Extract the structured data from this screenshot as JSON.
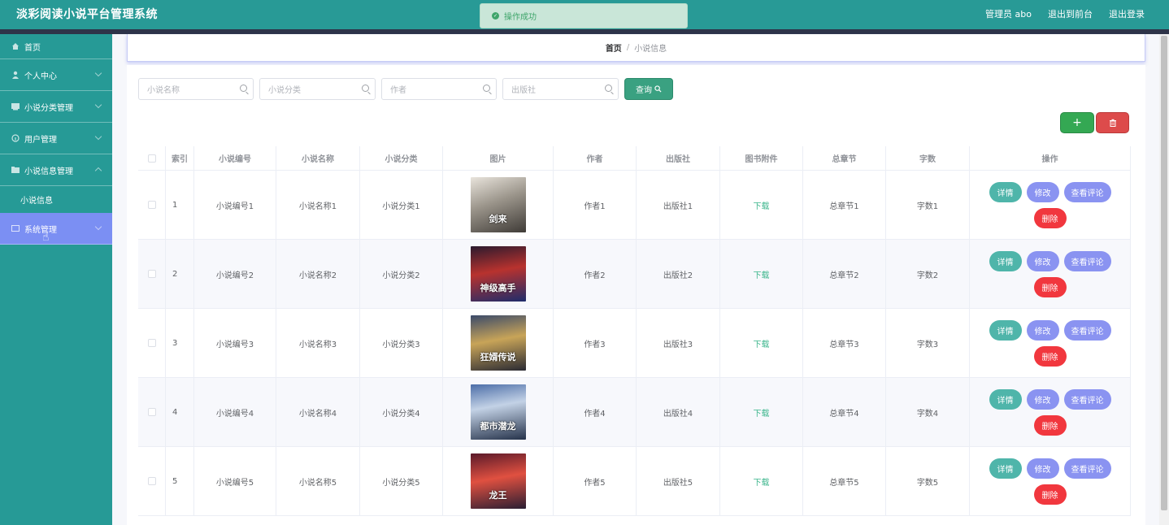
{
  "header": {
    "title": "淡彩阅读小说平台管理系统",
    "admin_label": "管理员 abo",
    "to_front_label": "退出到前台",
    "logout_label": "退出登录"
  },
  "toast": {
    "message": "操作成功"
  },
  "sidebar": {
    "items": [
      {
        "label": "首页",
        "icon": "home-icon"
      },
      {
        "label": "个人中心",
        "icon": "user-icon"
      },
      {
        "label": "小说分类管理",
        "icon": "list-icon"
      },
      {
        "label": "用户管理",
        "icon": "info-icon"
      },
      {
        "label": "小说信息管理",
        "icon": "folder-icon"
      },
      {
        "label": "小说信息",
        "icon": ""
      },
      {
        "label": "系统管理",
        "icon": "settings-icon"
      }
    ]
  },
  "breadcrumb": {
    "home": "首页",
    "separator": "/",
    "current": "小说信息"
  },
  "search": {
    "name_placeholder": "小说名称",
    "category_placeholder": "小说分类",
    "author_placeholder": "作者",
    "publisher_placeholder": "出版社",
    "query_label": "查询"
  },
  "toolbar": {
    "add_label": "+",
    "delete_label": "🗑"
  },
  "table": {
    "headers": [
      "",
      "索引",
      "小说编号",
      "小说名称",
      "小说分类",
      "图片",
      "作者",
      "出版社",
      "图书附件",
      "总章节",
      "字数",
      "操作"
    ],
    "rows": [
      {
        "index": "1",
        "code": "小说编号1",
        "name": "小说名称1",
        "category": "小说分类1",
        "cover_text": "剑来",
        "author": "作者1",
        "publisher": "出版社1",
        "attachment": "下载",
        "chapters": "总章节1",
        "words": "字数1"
      },
      {
        "index": "2",
        "code": "小说编号2",
        "name": "小说名称2",
        "category": "小说分类2",
        "cover_text": "神级高手",
        "author": "作者2",
        "publisher": "出版社2",
        "attachment": "下载",
        "chapters": "总章节2",
        "words": "字数2"
      },
      {
        "index": "3",
        "code": "小说编号3",
        "name": "小说名称3",
        "category": "小说分类3",
        "cover_text": "狂婿传说",
        "author": "作者3",
        "publisher": "出版社3",
        "attachment": "下载",
        "chapters": "总章节3",
        "words": "字数3"
      },
      {
        "index": "4",
        "code": "小说编号4",
        "name": "小说名称4",
        "category": "小说分类4",
        "cover_text": "都市潜龙",
        "author": "作者4",
        "publisher": "出版社4",
        "attachment": "下载",
        "chapters": "总章节4",
        "words": "字数4"
      },
      {
        "index": "5",
        "code": "小说编号5",
        "name": "小说名称5",
        "category": "小说分类5",
        "cover_text": "龙王",
        "author": "作者5",
        "publisher": "出版社5",
        "attachment": "下载",
        "chapters": "总章节5",
        "words": "字数5"
      }
    ],
    "actions": {
      "detail": "详情",
      "edit": "修改",
      "comment": "查看评论",
      "delete": "删除"
    }
  },
  "colors": {
    "header": "#289a96",
    "sidebar": "#269a96",
    "active_menu": "#7b8ff3",
    "delete": "#f1373e"
  }
}
